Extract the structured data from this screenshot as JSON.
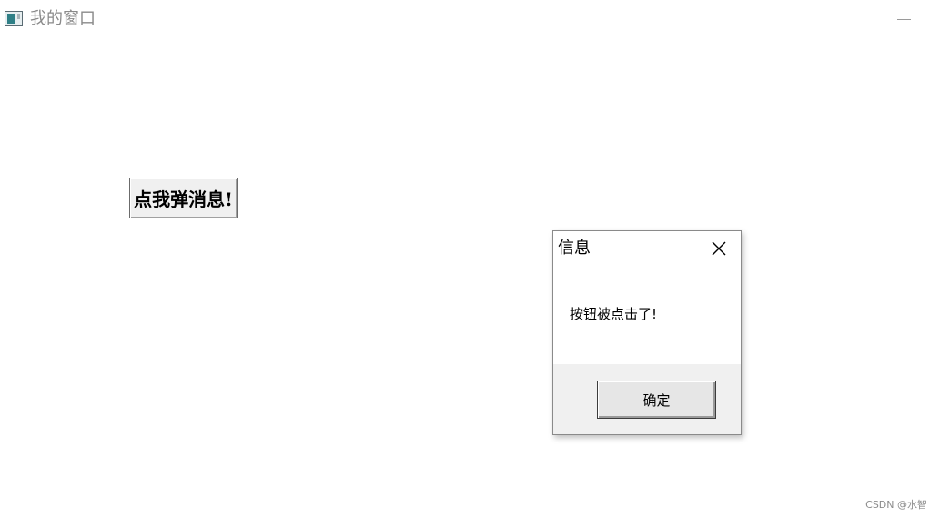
{
  "window": {
    "title": "我的窗口",
    "icon": "app-window-icon",
    "minimize_icon": "minimize-icon"
  },
  "main": {
    "button_label": "点我弹消息!"
  },
  "dialog": {
    "title": "信息",
    "close_icon": "close-icon",
    "message": "按钮被点击了!",
    "ok_label": "确定"
  },
  "watermark": "CSDN @水智"
}
